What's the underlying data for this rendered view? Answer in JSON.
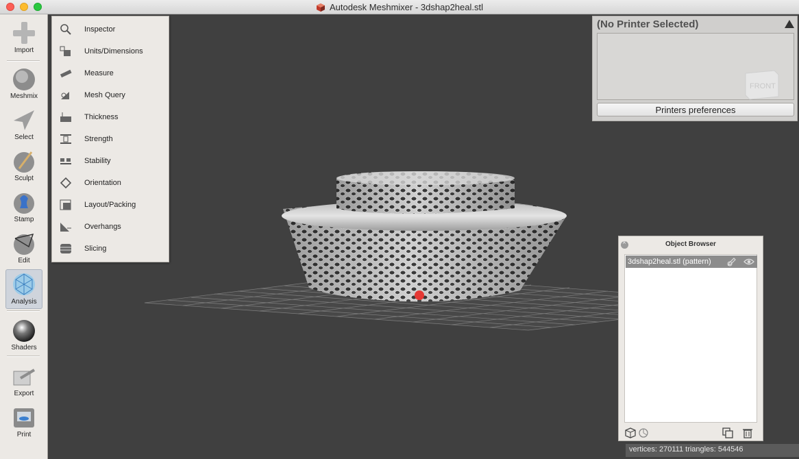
{
  "window": {
    "title": "Autodesk Meshmixer - 3dshap2heal.stl"
  },
  "toolbar": {
    "tools": [
      {
        "label": "Import",
        "icon": "plus-icon"
      },
      {
        "label": "Meshmix",
        "icon": "meshmix-bunny-icon"
      },
      {
        "label": "Select",
        "icon": "select-arrow-icon"
      },
      {
        "label": "Sculpt",
        "icon": "sculpt-brush-icon"
      },
      {
        "label": "Stamp",
        "icon": "stamp-icon"
      },
      {
        "label": "Edit",
        "icon": "edit-icon"
      },
      {
        "label": "Analysis",
        "icon": "analysis-icon",
        "active": true
      },
      {
        "label": "Shaders",
        "icon": "shaders-sphere-icon"
      },
      {
        "label": "Export",
        "icon": "export-icon"
      },
      {
        "label": "Print",
        "icon": "print-icon"
      }
    ]
  },
  "analysis_menu": {
    "items": [
      {
        "label": "Inspector",
        "icon": "magnifier-icon"
      },
      {
        "label": "Units/Dimensions",
        "icon": "units-icon"
      },
      {
        "label": "Measure",
        "icon": "ruler-icon"
      },
      {
        "label": "Mesh Query",
        "icon": "mesh-query-icon"
      },
      {
        "label": "Thickness",
        "icon": "thickness-icon"
      },
      {
        "label": "Strength",
        "icon": "strength-icon"
      },
      {
        "label": "Stability",
        "icon": "stability-icon"
      },
      {
        "label": "Orientation",
        "icon": "orientation-icon"
      },
      {
        "label": "Layout/Packing",
        "icon": "layout-packing-icon"
      },
      {
        "label": "Overhangs",
        "icon": "overhangs-icon"
      },
      {
        "label": "Slicing",
        "icon": "slicing-icon"
      }
    ]
  },
  "printer_panel": {
    "title": "(No Printer Selected)",
    "preferences_button": "Printers preferences",
    "cube_label": "FRONT"
  },
  "object_browser": {
    "title": "Object Browser",
    "objects": [
      {
        "name": "3dshap2heal.stl (pattern)",
        "selected": true
      }
    ]
  },
  "status": {
    "text": "vertices: 270111 triangles: 544546"
  },
  "colors": {
    "viewport_bg": "#404040",
    "panel_bg": "#ece9e5",
    "pivot_marker": "#e53935",
    "mesh": "#c8c8c8"
  }
}
